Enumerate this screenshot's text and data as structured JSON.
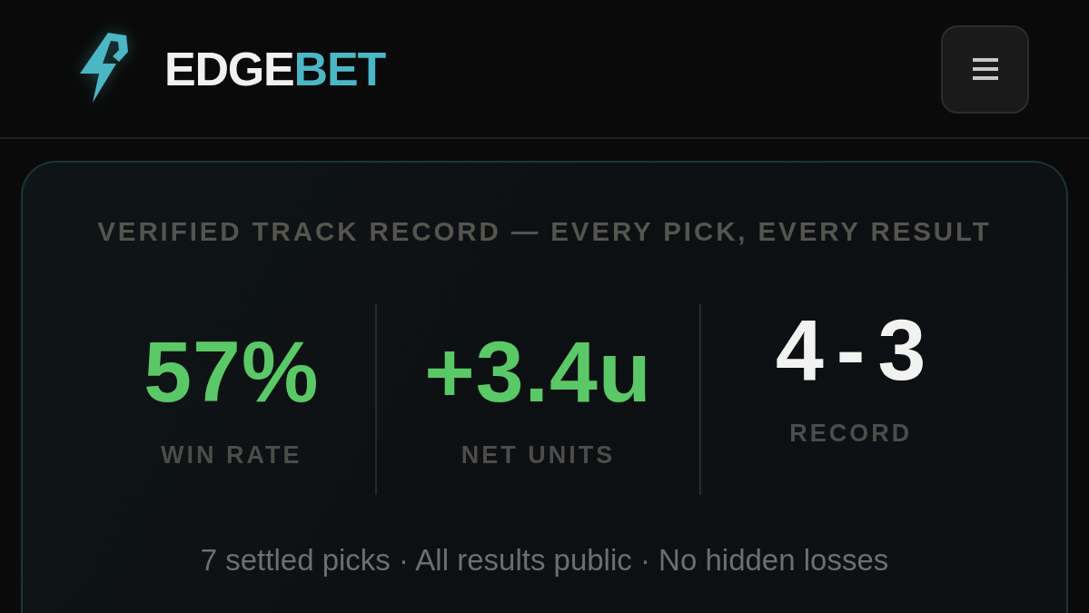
{
  "header": {
    "wordmark": [
      {
        "text": "EDGE",
        "kind": "base"
      },
      {
        "text": "BET",
        "kind": "accent"
      }
    ]
  },
  "track_record": {
    "title": "VERIFIED TRACK RECORD — EVERY PICK, EVERY RESULT",
    "stats": [
      {
        "value": "57%",
        "label": "WIN RATE",
        "color": "#5ac866"
      },
      {
        "value": "+3.4u",
        "label": "NET UNITS",
        "color": "#5ac866"
      },
      {
        "value": "4-3",
        "label": "RECORD",
        "color": "#f2f2f0"
      }
    ],
    "footnote": "7 settled picks · All results public · No hidden losses"
  }
}
